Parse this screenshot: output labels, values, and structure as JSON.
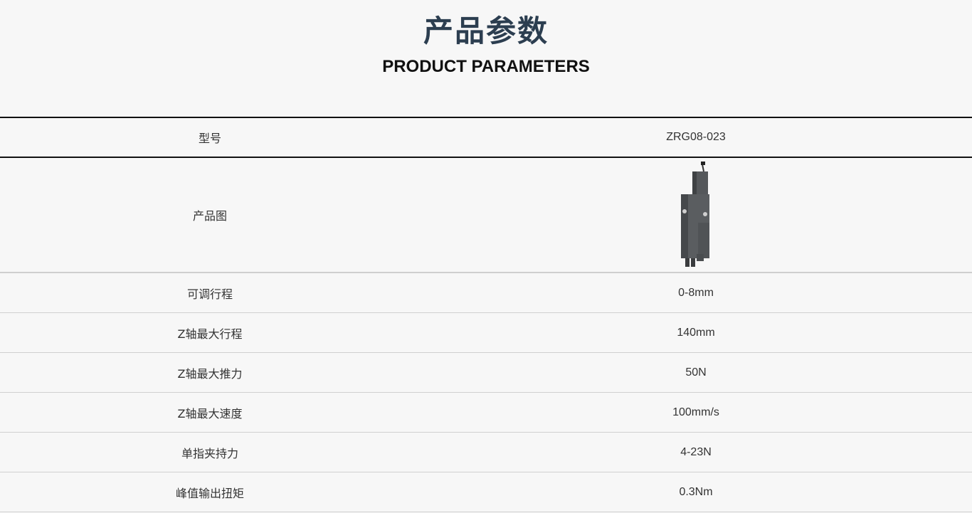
{
  "header": {
    "title_cn": "产品参数",
    "title_en": "PRODUCT PARAMETERS"
  },
  "table": {
    "rows": [
      {
        "label": "型号",
        "value": "ZRG08-023"
      },
      {
        "label": "产品图",
        "value": ""
      },
      {
        "label": "可调行程",
        "value": "0-8mm"
      },
      {
        "label": "Z轴最大行程",
        "value": "140mm"
      },
      {
        "label": "Z轴最大推力",
        "value": "50N"
      },
      {
        "label": "Z轴最大速度",
        "value": "100mm/s"
      },
      {
        "label": "单指夹持力",
        "value": "4-23N"
      },
      {
        "label": "峰值输出扭矩",
        "value": "0.3Nm"
      }
    ]
  },
  "colors": {
    "title": "#2c3e50",
    "background": "#f7f7f7",
    "product_body": "#5a5d60"
  },
  "product_image_icon": "gripper-product-image"
}
